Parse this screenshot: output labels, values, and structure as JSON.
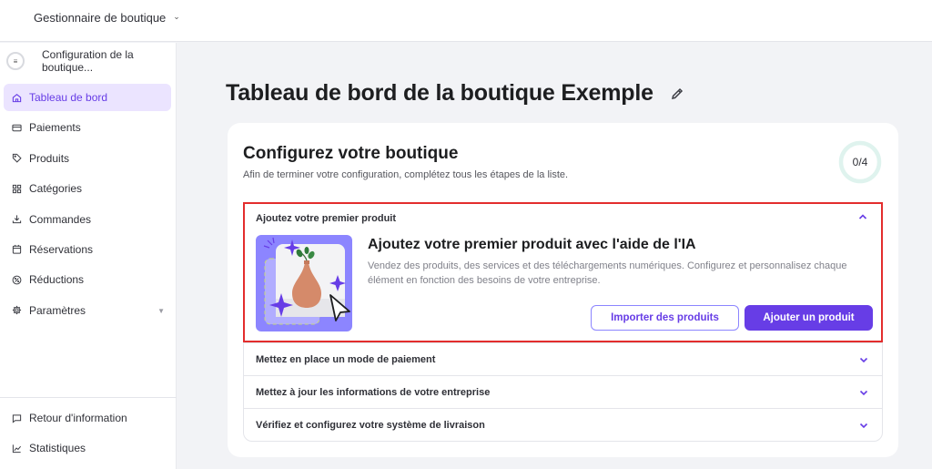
{
  "topbar": {
    "store_switcher": "Gestionnaire de boutique"
  },
  "sidebar": {
    "setup": {
      "label": "Configuration de la boutique...",
      "icon": "checklist-icon"
    },
    "items": [
      {
        "label": "Tableau de bord",
        "icon": "home-icon",
        "active": true
      },
      {
        "label": "Paiements",
        "icon": "credit-card-icon"
      },
      {
        "label": "Produits",
        "icon": "tag-icon"
      },
      {
        "label": "Catégories",
        "icon": "grid-icon"
      },
      {
        "label": "Commandes",
        "icon": "download-tray-icon"
      },
      {
        "label": "Réservations",
        "icon": "calendar-icon"
      },
      {
        "label": "Réductions",
        "icon": "discount-icon"
      },
      {
        "label": "Paramètres",
        "icon": "gear-icon",
        "expandable": true
      }
    ],
    "bottom_items": [
      {
        "label": "Retour d'information",
        "icon": "chat-icon"
      },
      {
        "label": "Statistiques",
        "icon": "chart-line-icon"
      }
    ]
  },
  "main": {
    "page_title": "Tableau de bord de la boutique Exemple",
    "setup_card": {
      "title": "Configurez votre boutique",
      "subtitle": "Afin de terminer votre configuration, complétez tous les étapes de la liste.",
      "progress_text": "0/4",
      "progress_completed": 0,
      "progress_total": 4,
      "open_step": {
        "header": "Ajoutez votre premier produit",
        "title": "Ajoutez votre premier produit avec l'aide de l'IA",
        "description": "Vendez des produits, des services et des téléchargements numériques. Configurez et personnalisez chaque élément en fonction des besoins de votre entreprise.",
        "import_button": "Importer des produits",
        "add_button": "Ajouter un produit"
      },
      "steps": [
        {
          "label": "Mettez en place un mode de paiement"
        },
        {
          "label": "Mettez à jour les informations de votre entreprise"
        },
        {
          "label": "Vérifiez et configurez votre système de livraison"
        }
      ]
    }
  },
  "colors": {
    "accent": "#673de6",
    "accent_light": "#ebe4ff",
    "highlight_border": "#e32d2d",
    "progress_ring": "#dff3ee"
  }
}
